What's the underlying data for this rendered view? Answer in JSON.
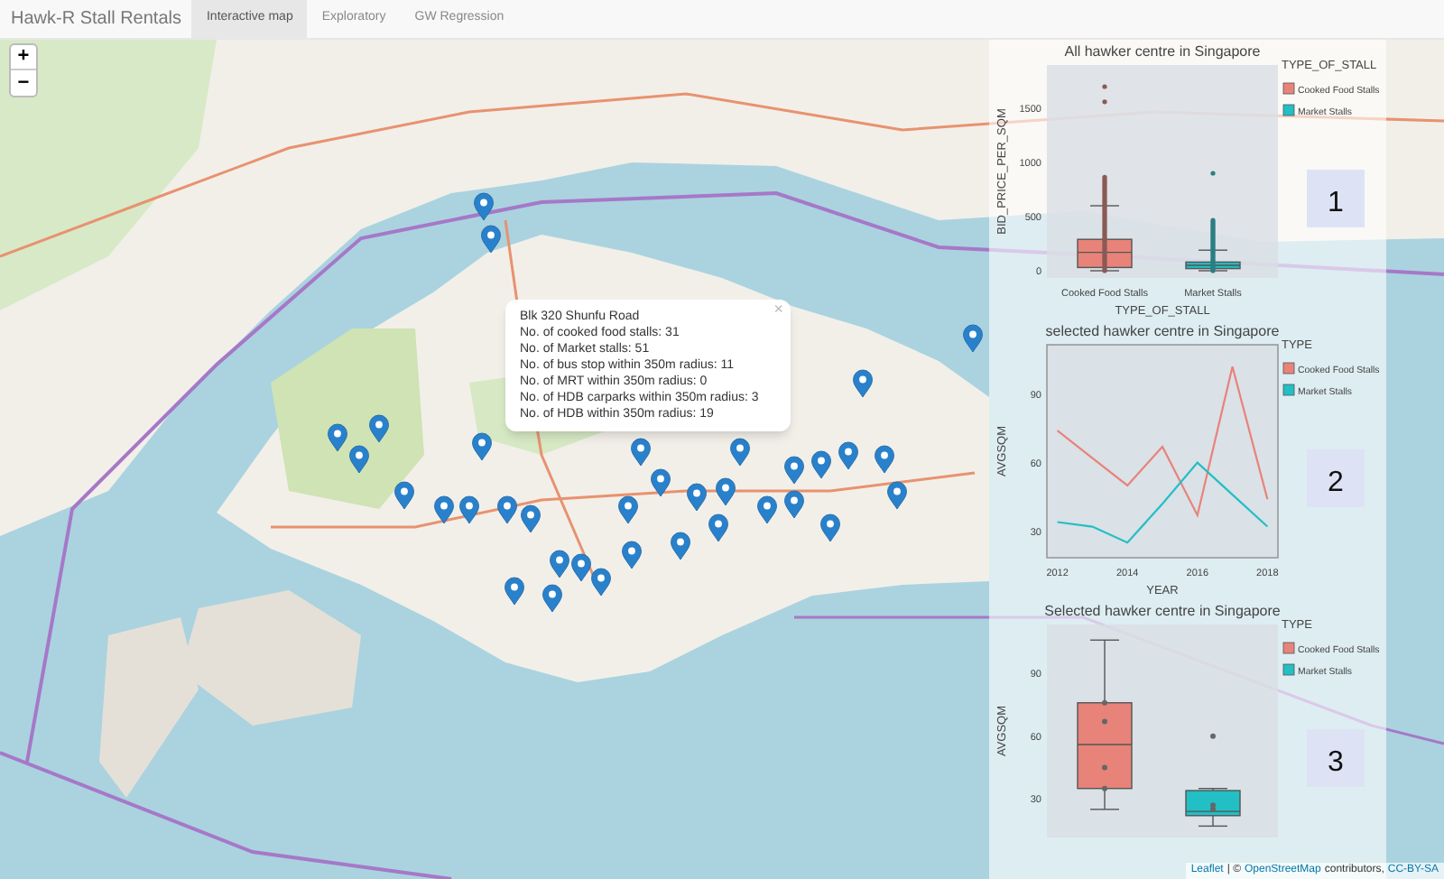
{
  "navbar": {
    "brand": "Hawk-R Stall Rentals",
    "tabs": [
      {
        "label": "Interactive map",
        "selected": true
      },
      {
        "label": "Exploratory",
        "selected": false
      },
      {
        "label": "GW Regression",
        "selected": false
      }
    ]
  },
  "map": {
    "zoom_controls": [
      "+",
      "−"
    ],
    "popup": {
      "close": "×",
      "lines": [
        "Blk 320 Shunfu Road",
        "No. of cooked food stalls: 31",
        "No. of Market stalls: 51",
        "No. of bus stop within 350m radius: 11",
        "No. of MRT within 350m radius: 0",
        "No. of HDB carparks within 350m radius: 3",
        "No. of HDB within 350m radius: 19"
      ]
    },
    "attribution": {
      "link": "Leaflet",
      "separator": "| ©",
      "osm": "OpenStreetMap",
      "contributors": "contributors,",
      "license": "CC-BY-SA"
    }
  },
  "charts": [
    {
      "kind": "box",
      "number": "1",
      "title": "All hawker centre in Singapore",
      "ylabel": "BID_PRICE_PER_SQM",
      "xlabel": "TYPE_OF_STALL",
      "legend_title": "TYPE_OF_STALL",
      "y_tick_labels": [
        "1500",
        "1000",
        "500",
        "0"
      ],
      "categories": [
        "Cooked Food Stalls",
        "Market Stalls"
      ],
      "legend": [
        {
          "label": "Cooked Food Stalls",
          "color": "#e8837a"
        },
        {
          "label": "Market Stalls",
          "color": "#22bfc4"
        }
      ]
    },
    {
      "kind": "line",
      "number": "2",
      "legend_title": "TYPE",
      "chart_data": {
        "type": "line",
        "title": "selected hawker centre in Singapore",
        "xlabel": "YEAR",
        "ylabel": "AVGSQM",
        "x": [
          2012,
          2013,
          2014,
          2015,
          2016,
          2017,
          2018
        ],
        "xticks": [
          2012,
          2014,
          2016,
          2018
        ],
        "xlim": [
          2011.7,
          2018.3
        ],
        "yticks": [
          30,
          60,
          90
        ],
        "ylim": [
          18.4,
          111.6
        ],
        "legend": "right",
        "series": [
          {
            "name": "Cooked Food Stalls",
            "color": "#e8837a",
            "values": [
              74,
              62,
              50,
              67,
              37,
              102,
              44
            ]
          },
          {
            "name": "Market Stalls",
            "color": "#22bfc4",
            "values": [
              34,
              32,
              25,
              42,
              60,
              46,
              32
            ]
          }
        ]
      }
    },
    {
      "kind": "box",
      "number": "3",
      "title": "Selected hawker centre in Singapore",
      "ylabel": "AVGSQM",
      "legend_title": "TYPE",
      "y_tick_labels": [
        "90",
        "60",
        "30"
      ],
      "legend": [
        {
          "label": "Cooked Food Stalls",
          "color": "#e8837a"
        },
        {
          "label": "Market Stalls",
          "color": "#22bfc4"
        }
      ]
    }
  ]
}
